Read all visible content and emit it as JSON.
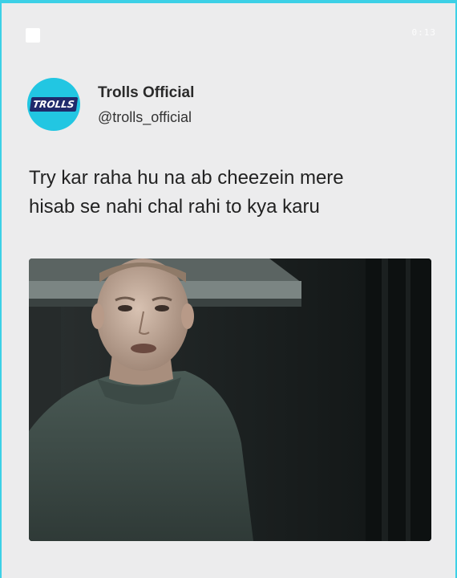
{
  "post": {
    "timer": "0:13",
    "author": {
      "display_name": "Trolls Official",
      "handle": "@trolls_official",
      "avatar_logo_text": "TROLLS"
    },
    "text_line1": "Try kar raha hu na ab cheezein mere",
    "text_line2": "hisab se nahi chal rahi to kya karu"
  },
  "colors": {
    "accent": "#3cd0e6",
    "avatar_bg": "#22c6e2",
    "background": "#ececed"
  }
}
